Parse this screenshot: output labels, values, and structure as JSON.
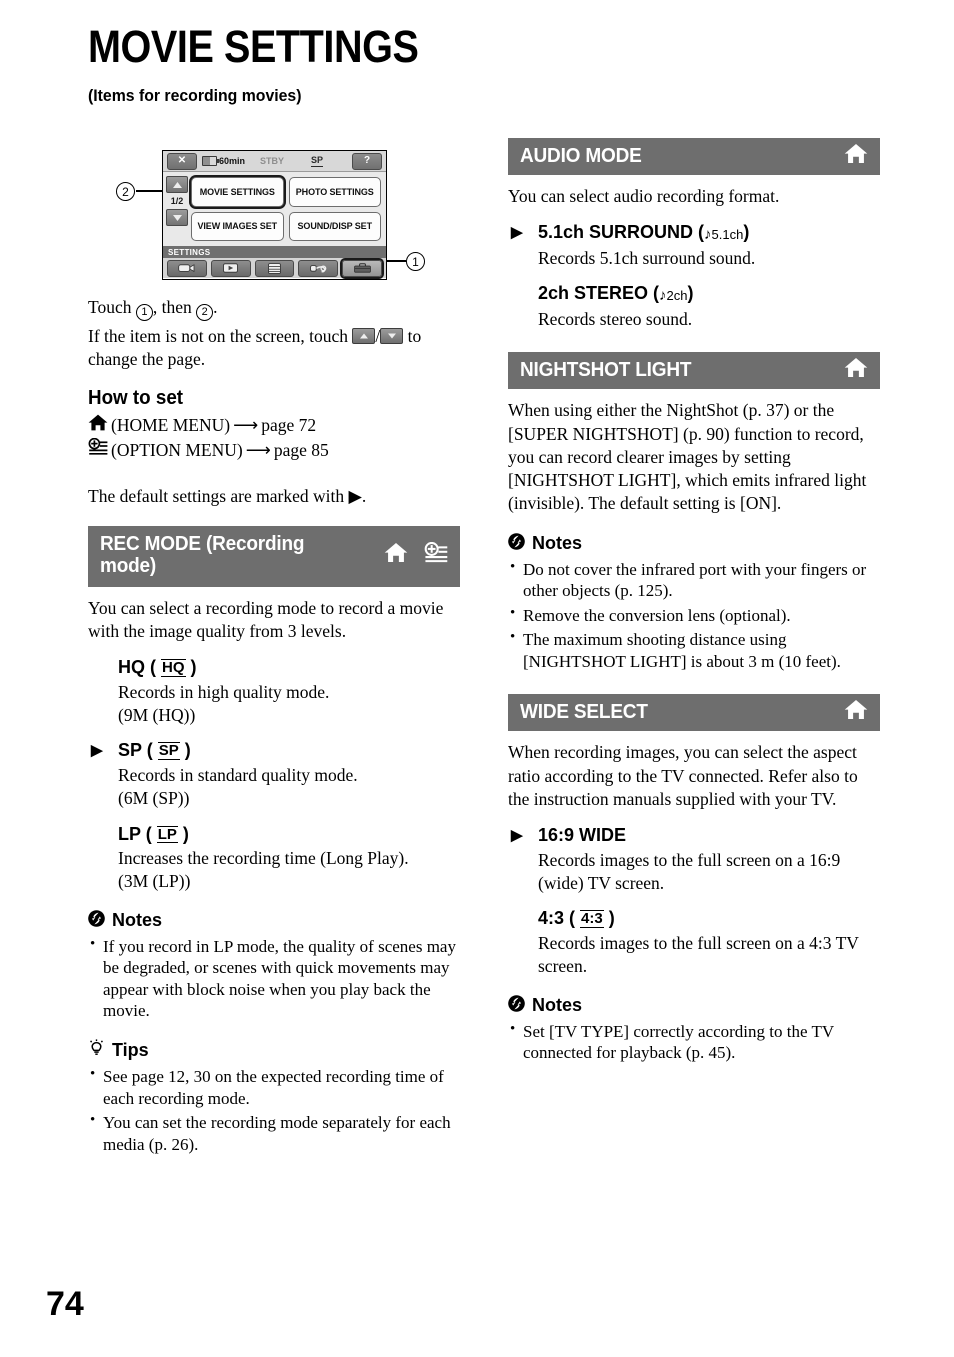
{
  "page": {
    "title": "MOVIE SETTINGS",
    "subtitle": "(Items for recording movies)",
    "number": "74",
    "header_bg": "#6e6e6e"
  },
  "figure": {
    "lcd": {
      "close_label": "✕",
      "battery_time": "60min",
      "status": "STBY",
      "rec_mode_indicator": "SP",
      "help_label": "?",
      "page_indicator": "1/2",
      "menu_buttons": [
        {
          "label": "MOVIE SETTINGS",
          "selected": true
        },
        {
          "label": "PHOTO SETTINGS",
          "selected": false
        },
        {
          "label": "VIEW IMAGES SET",
          "selected": false
        },
        {
          "label": "SOUND/DISP SET",
          "selected": false
        }
      ],
      "category_label": "SETTINGS",
      "tabs": [
        {
          "icon": "camera-icon",
          "selected": false
        },
        {
          "icon": "playback-icon",
          "selected": false
        },
        {
          "icon": "manage-media-icon",
          "selected": false
        },
        {
          "icon": "others-icon",
          "selected": false
        },
        {
          "icon": "settings-toolbox-icon",
          "selected": true
        }
      ]
    },
    "callouts": {
      "one": "1",
      "two": "2"
    }
  },
  "intro": {
    "touch_line_a": "Touch ",
    "touch_line_b": ", then ",
    "touch_line_c": ".",
    "notfound_a": "If the item is not on the screen, touch ",
    "notfound_b": "/",
    "notfound_c": " to change the page."
  },
  "how_to_set": {
    "heading": "How to set",
    "home_label": "(HOME MENU)",
    "home_arrow": "⟶",
    "home_page": "page 72",
    "option_label": "(OPTION MENU)",
    "option_arrow": "⟶",
    "option_page": "page 85",
    "default_note": "The default settings are marked with ▶."
  },
  "sections": {
    "rec_mode": {
      "title": "REC MODE (Recording mode)",
      "icons": [
        "home-icon",
        "option-menu-icon"
      ],
      "intro": "You can select a recording mode to record a movie with the image quality from 3 levels.",
      "options": [
        {
          "name": "HQ",
          "symbol": "HQ",
          "default": false,
          "desc": "Records in high quality mode.",
          "desc2": "(9M (HQ))"
        },
        {
          "name": "SP",
          "symbol": "SP",
          "default": true,
          "desc": "Records in standard quality mode.",
          "desc2": "(6M (SP))"
        },
        {
          "name": "LP",
          "symbol": "LP",
          "default": false,
          "desc": "Increases the recording time (Long Play).",
          "desc2": "(3M (LP))"
        }
      ],
      "notes_heading": "Notes",
      "notes": [
        "If you record in LP mode, the quality of scenes may be degraded, or scenes with quick movements may appear with block noise when you play back the movie."
      ],
      "tips_heading": "Tips",
      "tips": [
        "See page 12, 30 on the expected recording time of each recording mode.",
        "You can set the recording mode separately for each media (p. 26)."
      ]
    },
    "audio_mode": {
      "title": "AUDIO MODE",
      "icons": [
        "home-icon"
      ],
      "intro": "You can select audio recording format.",
      "options": [
        {
          "name": "5.1ch SURROUND",
          "symbol_note": "♪",
          "symbol_ch": "5.1ch",
          "default": true,
          "desc": "Records 5.1ch surround sound."
        },
        {
          "name": "2ch STEREO",
          "symbol_note": "♪",
          "symbol_ch": "2ch",
          "default": false,
          "desc": "Records stereo sound."
        }
      ]
    },
    "nightshot_light": {
      "title": "NIGHTSHOT LIGHT",
      "icons": [
        "home-icon"
      ],
      "intro": "When using either the NightShot (p. 37) or the [SUPER NIGHTSHOT] (p. 90) function to record, you can record clearer images by setting [NIGHTSHOT LIGHT], which emits infrared light (invisible). The default setting is [ON].",
      "notes_heading": "Notes",
      "notes": [
        "Do not cover the infrared port with your fingers or other objects (p. 125).",
        "Remove the conversion lens (optional).",
        "The maximum shooting distance using [NIGHTSHOT LIGHT] is about 3 m (10 feet)."
      ]
    },
    "wide_select": {
      "title": "WIDE SELECT",
      "icons": [
        "home-icon"
      ],
      "intro": "When recording images, you can select the aspect ratio according to the TV connected. Refer also to the instruction manuals supplied with your TV.",
      "options": [
        {
          "name": "16:9 WIDE",
          "symbol": "",
          "default": true,
          "desc": "Records images to the full screen on a 16:9 (wide) TV screen."
        },
        {
          "name": "4:3",
          "symbol": "4:3",
          "default": false,
          "desc": "Records images to the full screen on a 4:3 TV screen."
        }
      ],
      "notes_heading": "Notes",
      "notes": [
        "Set [TV TYPE] correctly according to the TV connected for playback (p. 45)."
      ]
    }
  }
}
